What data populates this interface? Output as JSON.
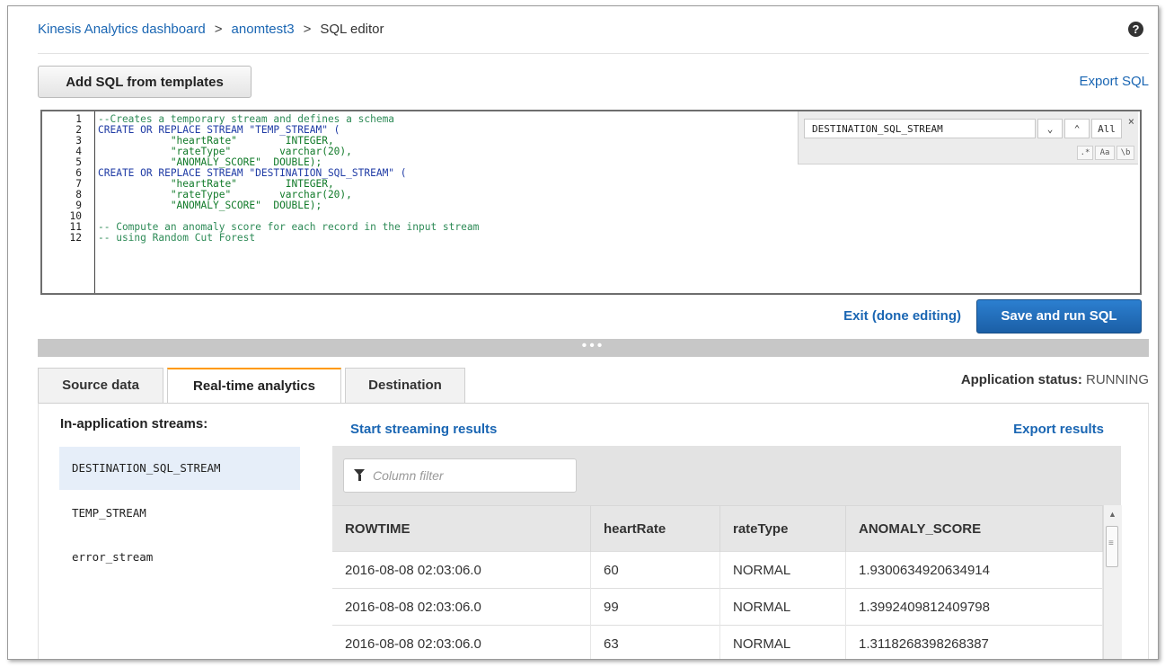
{
  "breadcrumb": {
    "dashboard": "Kinesis Analytics dashboard",
    "app": "anomtest3",
    "current": "SQL editor",
    "sep": ">"
  },
  "help_glyph": "?",
  "toolbar": {
    "templates_label": "Add SQL from templates",
    "export_sql_label": "Export SQL"
  },
  "editor": {
    "line_numbers": [
      "1",
      "2",
      "3",
      "4",
      "5",
      "6",
      "7",
      "8",
      "9",
      "10",
      "11",
      "12"
    ],
    "lines": [
      "--Creates a temporary stream and defines a schema",
      "CREATE OR REPLACE STREAM \"TEMP_STREAM\" (",
      "            \"heartRate\"        INTEGER,",
      "            \"rateType\"        varchar(20),",
      "            \"ANOMALY_SCORE\"  DOUBLE);",
      "CREATE OR REPLACE STREAM \"DESTINATION_SQL_STREAM\" (",
      "            \"heartRate\"        INTEGER,",
      "            \"rateType\"        varchar(20),",
      "            \"ANOMALY_SCORE\"  DOUBLE);",
      "",
      "-- Compute an anomaly score for each record in the input stream",
      "-- using Random Cut Forest"
    ],
    "find": {
      "query": "DESTINATION_SQL_STREAM",
      "next_glyph": "⌄",
      "prev_glyph": "⌃",
      "all_label": "All",
      "close_glyph": "×",
      "regex_label": ".*",
      "case_label": "Aa",
      "word_label": "\\b"
    }
  },
  "actions": {
    "exit_label": "Exit (done editing)",
    "save_run_label": "Save and run SQL"
  },
  "splitter_glyph": "•••",
  "tabs": [
    {
      "label": "Source data"
    },
    {
      "label": "Real-time analytics"
    },
    {
      "label": "Destination"
    }
  ],
  "status": {
    "label": "Application status:",
    "value": "RUNNING"
  },
  "streams": {
    "label": "In-application streams:",
    "items": [
      "DESTINATION_SQL_STREAM",
      "TEMP_STREAM",
      "error_stream"
    ]
  },
  "results": {
    "start_label": "Start streaming results",
    "export_label": "Export results",
    "filter_placeholder": "Column filter",
    "columns": [
      "ROWTIME",
      "heartRate",
      "rateType",
      "ANOMALY_SCORE"
    ],
    "rows": [
      [
        "2016-08-08 02:03:06.0",
        "60",
        "NORMAL",
        "1.9300634920634914"
      ],
      [
        "2016-08-08 02:03:06.0",
        "99",
        "NORMAL",
        "1.3992409812409798"
      ],
      [
        "2016-08-08 02:03:06.0",
        "63",
        "NORMAL",
        "1.3118268398268387"
      ]
    ]
  },
  "scroll": {
    "up_glyph": "▲",
    "grip_glyph": "≡"
  }
}
